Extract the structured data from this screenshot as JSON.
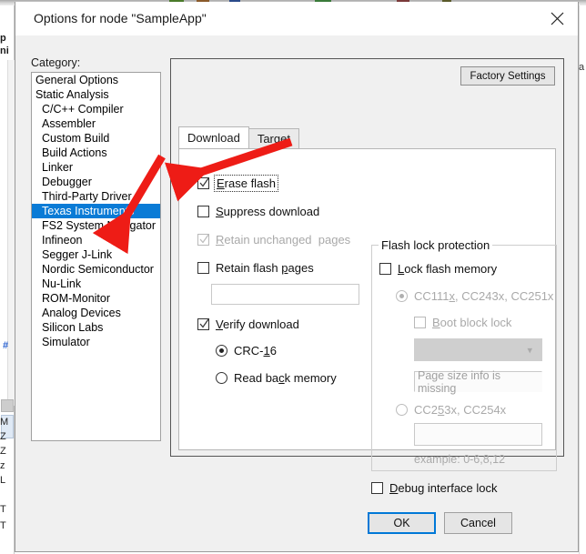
{
  "window": {
    "title": "Options for node \"SampleApp\"",
    "close_icon": "close-icon"
  },
  "background_app": {
    "left_fragments": [
      "p",
      "ni"
    ],
    "left_fragments_bottom": [
      "M",
      "Z",
      "Z",
      "z",
      "L",
      "T",
      "T"
    ],
    "right_fragment": "a",
    "blue_marker": "#"
  },
  "category": {
    "label": "Category:",
    "items": [
      {
        "label": "General Options",
        "indent": false,
        "selected": false
      },
      {
        "label": "Static Analysis",
        "indent": false,
        "selected": false
      },
      {
        "label": "C/C++ Compiler",
        "indent": true,
        "selected": false
      },
      {
        "label": "Assembler",
        "indent": true,
        "selected": false
      },
      {
        "label": "Custom Build",
        "indent": true,
        "selected": false
      },
      {
        "label": "Build Actions",
        "indent": true,
        "selected": false
      },
      {
        "label": "Linker",
        "indent": true,
        "selected": false
      },
      {
        "label": "Debugger",
        "indent": true,
        "selected": false
      },
      {
        "label": "Third-Party Driver",
        "indent": true,
        "selected": false
      },
      {
        "label": "Texas Instruments",
        "indent": true,
        "selected": true
      },
      {
        "label": "FS2 System Navigator",
        "indent": true,
        "selected": false
      },
      {
        "label": "Infineon",
        "indent": true,
        "selected": false
      },
      {
        "label": "Segger J-Link",
        "indent": true,
        "selected": false
      },
      {
        "label": "Nordic Semiconductor",
        "indent": true,
        "selected": false
      },
      {
        "label": "Nu-Link",
        "indent": true,
        "selected": false
      },
      {
        "label": "ROM-Monitor",
        "indent": true,
        "selected": false
      },
      {
        "label": "Analog Devices",
        "indent": true,
        "selected": false
      },
      {
        "label": "Silicon Labs",
        "indent": true,
        "selected": false
      },
      {
        "label": "Simulator",
        "indent": true,
        "selected": false
      }
    ]
  },
  "panel": {
    "factory_settings_label": "Factory Settings",
    "tabs": [
      {
        "label": "Download",
        "active": true
      },
      {
        "label": "Target",
        "active": false
      }
    ]
  },
  "download": {
    "erase_flash": {
      "label": "Erase flash",
      "checked": true,
      "enabled": true,
      "focused": true
    },
    "suppress_download": {
      "label": "Suppress download",
      "checked": false,
      "enabled": true
    },
    "retain_unchanged_pages": {
      "label": "Retain unchanged  pages",
      "checked": true,
      "enabled": false
    },
    "retain_flash_pages": {
      "label": "Retain flash pages",
      "checked": false,
      "enabled": true
    },
    "retain_flash_pages_value": "",
    "verify_download": {
      "label": "Verify download",
      "checked": true,
      "enabled": true
    },
    "crc16": {
      "label": "CRC-16",
      "selected": true,
      "enabled": true
    },
    "read_back_memory": {
      "label": "Read back memory",
      "selected": false,
      "enabled": true
    }
  },
  "flash_lock": {
    "legend": "Flash lock protection",
    "lock_flash_memory": {
      "label": "Lock flash memory",
      "checked": false,
      "enabled": true
    },
    "cc111x_group": {
      "label": "CC111x, CC243x, CC251x",
      "selected": true,
      "enabled": false
    },
    "boot_block_lock": {
      "label": "Boot block lock",
      "checked": false,
      "enabled": false
    },
    "page_combo_value": "",
    "page_size_text": "Page size info is missing",
    "cc253x_group": {
      "label": "CC253x, CC254x",
      "selected": false,
      "enabled": false
    },
    "cc253x_value": "",
    "example_hint": "example: 0-6,8,12"
  },
  "debug_interface_lock": {
    "label": "Debug interface lock",
    "checked": false,
    "enabled": true
  },
  "buttons": {
    "ok": "OK",
    "cancel": "Cancel"
  },
  "colors": {
    "selection_blue": "#0a7bd6",
    "focus_blue": "#0078d7",
    "dialog_bg": "#f0f0f0",
    "panel_white": "#ffffff",
    "arrow_red": "#ee1c16"
  }
}
